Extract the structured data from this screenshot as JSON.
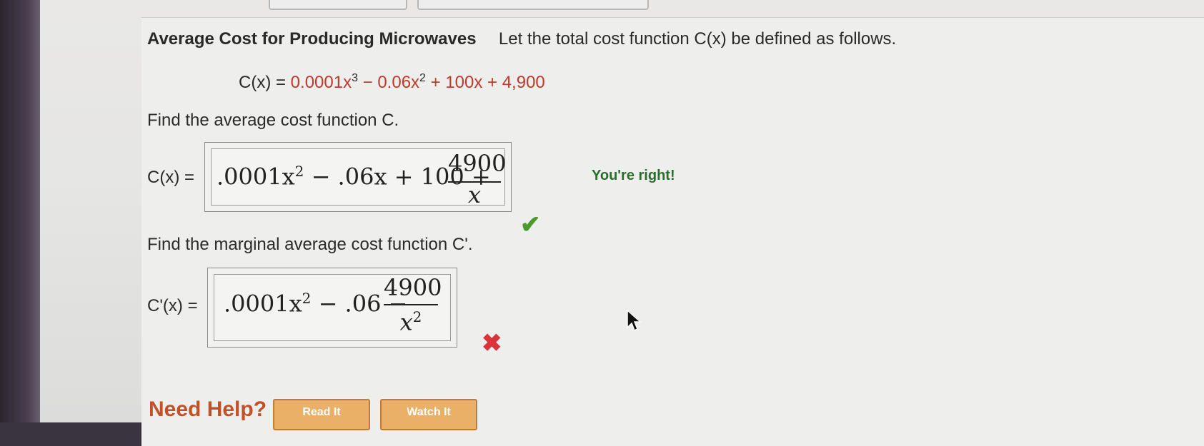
{
  "problem": {
    "title": "Average Cost for Producing Microwaves",
    "intro": "Let the total cost function C(x) be defined as follows.",
    "cost_lhs": "C(x) = ",
    "cost_terms": [
      "0.0001x",
      "3",
      " − 0.06x",
      "2",
      " + 100x + 4,900"
    ]
  },
  "part1": {
    "prompt": "Find the average cost function C.",
    "lhs": "C(x) =",
    "answer_main": ".0001x",
    "answer_exp": "2",
    "answer_rest": " − .06x + 100 +",
    "frac_num": "4900",
    "frac_den": "x",
    "feedback": "You're right!"
  },
  "part2": {
    "prompt": "Find the marginal average cost function C'.",
    "lhs": "C'(x) =",
    "answer_main": ".0001x",
    "answer_exp": "2",
    "answer_rest": " − .06 −",
    "frac_num": "4900",
    "frac_den": "x",
    "frac_den_exp": "2"
  },
  "footer": {
    "help_label": "Need Help?",
    "read_label": "Read It",
    "watch_label": "Watch It"
  },
  "icons": {
    "correct": "check-icon",
    "incorrect": "cross-icon",
    "cursor": "mouse-cursor-icon"
  },
  "colors": {
    "correct": "#4a9a2e",
    "incorrect": "#d9343b",
    "coefficient": "#c0392b"
  }
}
